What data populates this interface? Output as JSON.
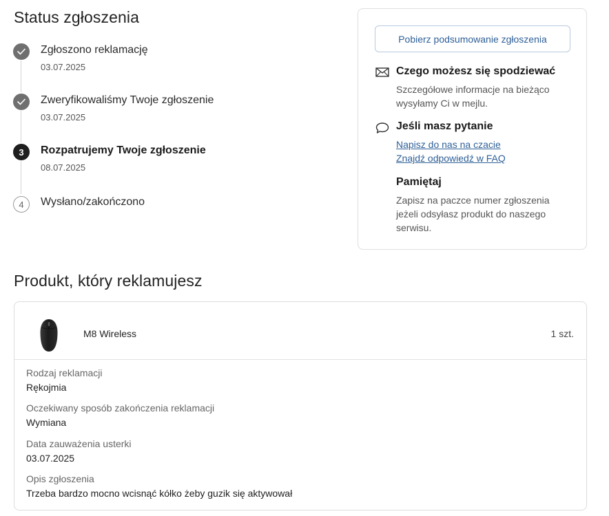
{
  "status": {
    "heading": "Status zgłoszenia",
    "steps": [
      {
        "number": "",
        "title": "Zgłoszono reklamację",
        "date": "03.07.2025",
        "state": "done"
      },
      {
        "number": "",
        "title": "Zweryfikowaliśmy Twoje zgłoszenie",
        "date": "03.07.2025",
        "state": "done"
      },
      {
        "number": "3",
        "title": "Rozpatrujemy Twoje zgłoszenie",
        "date": "08.07.2025",
        "state": "current"
      },
      {
        "number": "4",
        "title": "Wysłano/zakończono",
        "date": "",
        "state": "todo"
      }
    ]
  },
  "info": {
    "download_button": "Pobierz podsumowanie zgłoszenia",
    "expect": {
      "icon": "envelope-icon",
      "heading": "Czego możesz się spodziewać",
      "text": "Szczegółowe informacje na bieżąco wysyłamy Ci w mejlu."
    },
    "question": {
      "icon": "chat-bubble-icon",
      "heading": "Jeśli masz pytanie",
      "link_chat": "Napisz do nas na czacie",
      "link_faq": "Znajdź odpowiedź w FAQ"
    },
    "remember": {
      "heading": "Pamiętaj",
      "text": "Zapisz na paczce numer zgłoszenia jeżeli odsyłasz produkt do naszego serwisu."
    },
    "colors": {
      "link": "#2e5f97",
      "border": "#dedede"
    }
  },
  "product": {
    "heading": "Produkt, który reklamujesz",
    "name": "M8 Wireless",
    "quantity": "1 szt.",
    "image": "wireless-mouse-image",
    "details": [
      {
        "label": "Rodzaj reklamacji",
        "value": "Rękojmia"
      },
      {
        "label": "Oczekiwany sposób zakończenia reklamacji",
        "value": "Wymiana"
      },
      {
        "label": "Data zauważenia usterki",
        "value": "03.07.2025"
      },
      {
        "label": "Opis zgłoszenia",
        "value": "Trzeba bardzo mocno wcisnąć kółko żeby guzik się aktywował"
      }
    ]
  }
}
